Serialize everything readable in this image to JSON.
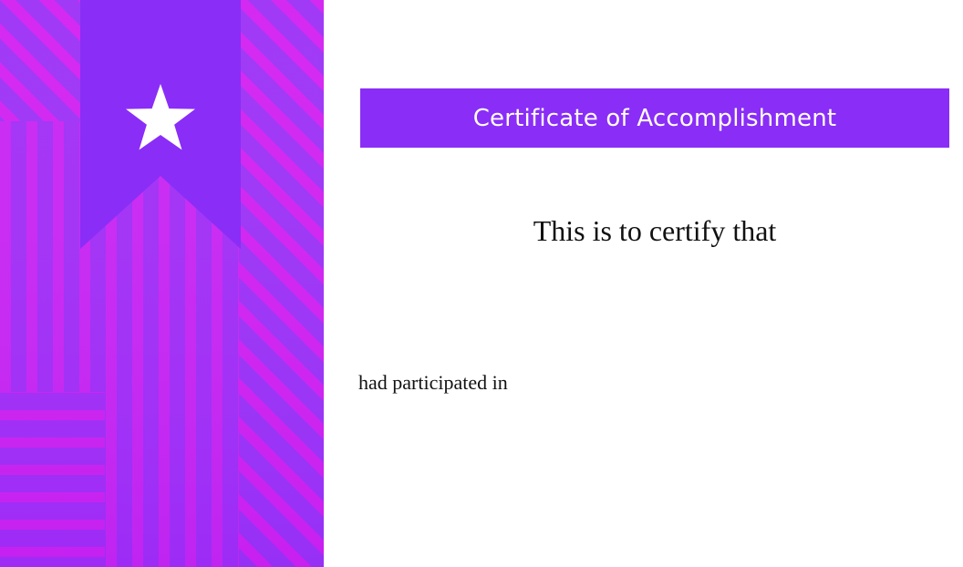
{
  "certificate": {
    "title": "Certificate of Accomplishment",
    "certify_text": "This is to certify that",
    "participated_text": "had participated in"
  },
  "decoration": {
    "ribbon_icon": "star-icon",
    "accent_color": "#8a2df7",
    "magenta_color": "#d41ef0"
  }
}
